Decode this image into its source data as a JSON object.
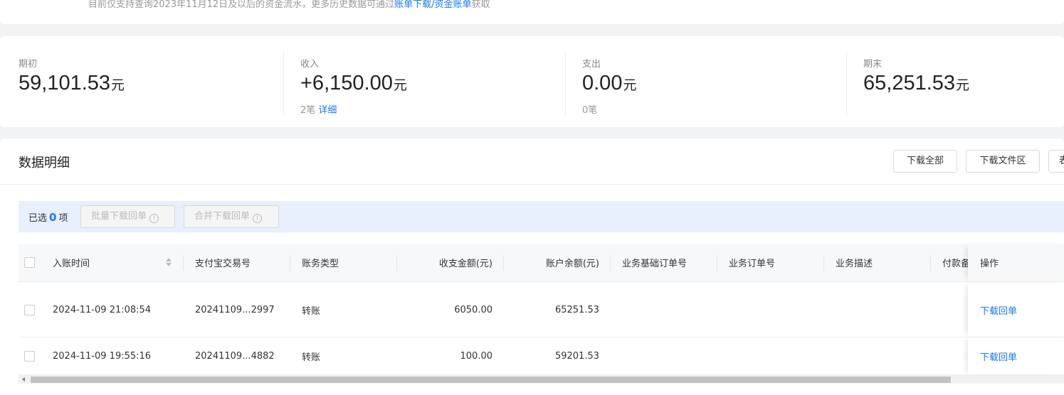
{
  "notice": {
    "text_before": "目前仅支持查询2023年11月12日及以后的资金流水，更多历史数据可通过",
    "link": "账单下载/资金账单",
    "text_after": "获取"
  },
  "summary": {
    "opening": {
      "label": "期初",
      "value": "59,101.53",
      "unit": "元"
    },
    "income": {
      "label": "收入",
      "value": "+6,150.00",
      "unit": "元",
      "count": "2笔",
      "link": "详细"
    },
    "expense": {
      "label": "支出",
      "value": "0.00",
      "unit": "元",
      "count": "0笔"
    },
    "closing": {
      "label": "期末",
      "value": "65,251.53",
      "unit": "元"
    }
  },
  "detail": {
    "title": "数据明细",
    "buttons": {
      "download_all": "下载全部",
      "download_area": "下载文件区",
      "more": "表"
    }
  },
  "selection": {
    "prefix": "已选",
    "count": "0",
    "suffix": "项",
    "batch_download": "批量下载回单",
    "merge_download": "合并下载回单"
  },
  "table": {
    "columns": [
      "入账时间",
      "支付宝交易号",
      "账务类型",
      "收支金额(元)",
      "账户余额(元)",
      "业务基础订单号",
      "业务订单号",
      "业务描述",
      "付款备",
      "操作"
    ],
    "rows": [
      {
        "time": "2024-11-09 21:08:54",
        "trade_no": "20241109...2997",
        "type": "转账",
        "amount": "6050.00",
        "balance": "65251.53",
        "action": "下载回单"
      },
      {
        "time": "2024-11-09 19:55:16",
        "trade_no": "20241109...4882",
        "type": "转账",
        "amount": "100.00",
        "balance": "59201.53",
        "action": "下载回单"
      }
    ]
  },
  "colors": {
    "accent": "#1677ff",
    "selection_bg": "#e8f0fe"
  },
  "icons": {
    "sort": "sort-icon",
    "info": "info-icon"
  }
}
